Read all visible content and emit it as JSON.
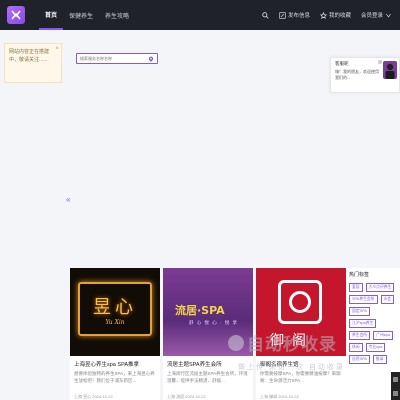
{
  "topbar": {
    "nav": [
      {
        "label": "首页",
        "active": true
      },
      {
        "label": "保健养生",
        "active": false
      },
      {
        "label": "养生攻略",
        "active": false
      }
    ],
    "publish_label": "发布信息",
    "favorites_label": "我的收藏",
    "login_label": "会员登录"
  },
  "notice": {
    "text": "网站内容正在搭建中，敬请关注......",
    "close": "×"
  },
  "search": {
    "placeholder": "搜索服务名称名称"
  },
  "chat": {
    "title": "客服昵",
    "message": "嗨！我的朋友，欢迎使用我们的..."
  },
  "cards": [
    {
      "title": "上海昱心养生spa SPA推拿",
      "desc": "想要体验独特的养生SPA，来上海昱心养生放松吧！我们位于浦东新区...",
      "meta": "上海 昱心 2024-10-22",
      "image_text_big": "昱心",
      "image_text_small": "Yu Xin"
    },
    {
      "title": "流居主题SPA养生会所",
      "desc": "上海闵行区流居主题SPA养生会所，环境温馨，提供手法精湛、舒缓...",
      "meta": "上海 流居 2024-10-22",
      "image_text_big": "流居·SPA",
      "image_text_small": "舒 心 悦 心 · 悦 享"
    },
    {
      "title": "御阁名宿养生馆",
      "desc": "你需要按摩SPA，你需要精油按摩？来御阁：生命源活力SPA...",
      "meta": "上海 御阁 2024-10-22",
      "image_text_big": "御阁"
    }
  ],
  "hot_tags": {
    "title": "热门标签",
    "tags": [
      "爱容",
      "大众点评养生",
      "SPA养生会所",
      "水会",
      "固定SPA",
      "江沪spa养生",
      "养生会所",
      "广州spa",
      "休闲",
      "专业spa",
      "自然SPA",
      "推拿"
    ]
  },
  "watermark": {
    "big": "自动秒收录",
    "small": "做上传 来访一次 自动收录"
  },
  "colors": {
    "topbar": "#1f2329",
    "accent": "#7b5cf0",
    "notice_bg": "#fff8ea"
  }
}
